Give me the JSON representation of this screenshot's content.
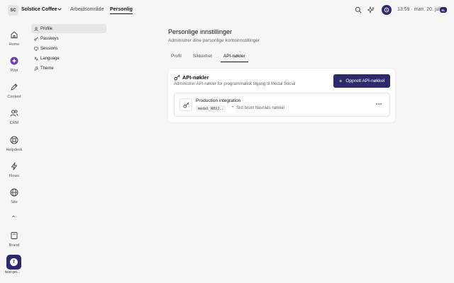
{
  "header": {
    "workspace_initials": "SC",
    "workspace_name": "Solstice Coffee",
    "nav": [
      "Arbeidsområde",
      "Personlig"
    ],
    "time": "13:59",
    "separator": "·",
    "date": "man. 20. juli",
    "language_badge": "EL"
  },
  "rail": {
    "items": [
      "Home",
      "Pilot",
      "Content",
      "CRM",
      "Helpdesk",
      "Flows",
      "Site",
      "Brand"
    ],
    "app_tile_letter": "T",
    "app_label": "test-pri..."
  },
  "sidebar": {
    "items": [
      "Profile",
      "Passkeys",
      "Sessions",
      "Language",
      "Theme"
    ]
  },
  "main": {
    "title": "Personlige innstillinger",
    "subtitle": "Administrer dine personlige kontoinnstillinger",
    "tabs": [
      "Profil",
      "Sikkerhet",
      "API-nøkler"
    ],
    "api_card": {
      "title": "API-nøkler",
      "subtitle": "Administrer API-nøkler for programmatisk tilgang til Medal Social",
      "create_button": "Opprett API-nøkkel",
      "create_icon": "plus-icon",
      "keys": [
        {
          "name": "Production integration",
          "prefix": "medal_W8VJ..",
          "dot": "•",
          "last_used": "Sist brukt Navnløs nøkkel"
        }
      ]
    }
  },
  "colors": {
    "accent": "#2c2a6b",
    "background": "#f6f6f7",
    "card": "#ffffff"
  }
}
